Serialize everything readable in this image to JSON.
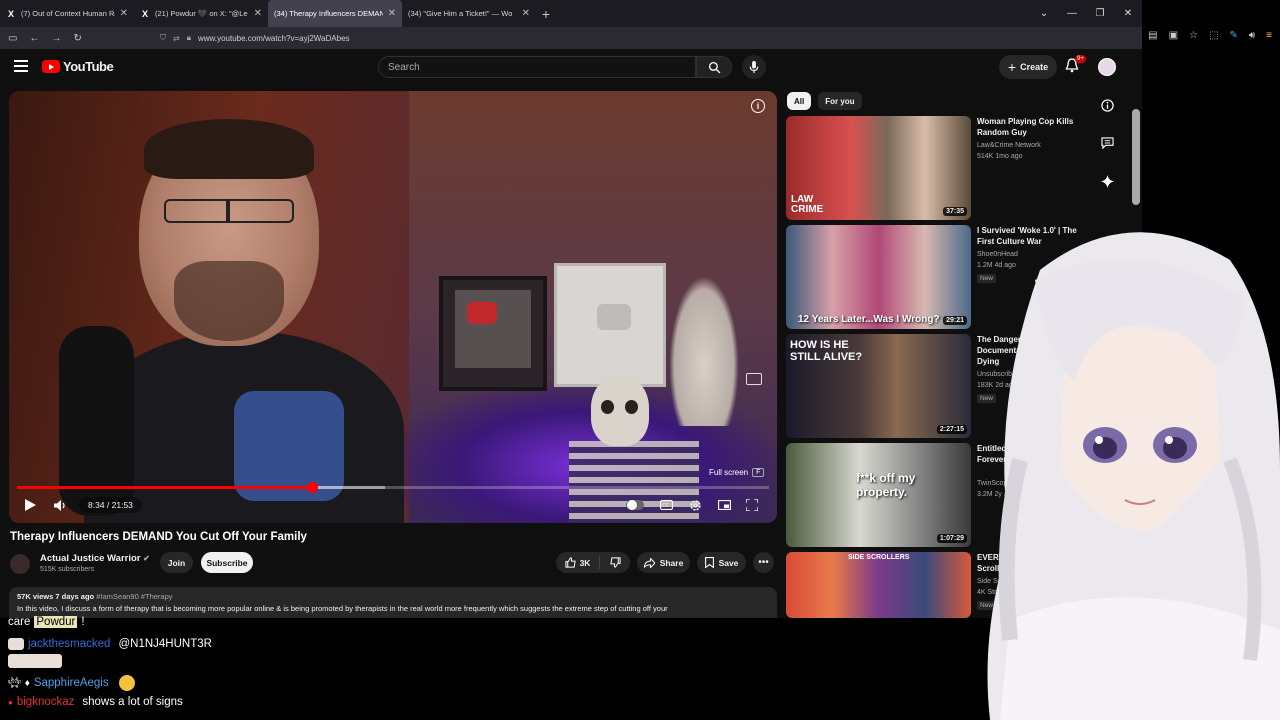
{
  "browser": {
    "tabs": [
      {
        "title": "(7) Out of Context Human Race",
        "icon": "x-icon",
        "active": false
      },
      {
        "title": "(21) Powdur 🖤 on X: \"@Le",
        "icon": "x-icon",
        "active": false
      },
      {
        "title": "(34) Therapy Influencers DEMAN",
        "icon": "youtube-icon",
        "active": true
      },
      {
        "title": "(34) \"Give Him a Ticket!\" — Wo",
        "icon": "youtube-icon",
        "active": false
      }
    ],
    "url": "www.youtube.com/watch?v=ayj2WaDAbes"
  },
  "youtube": {
    "logo_text": "YouTube",
    "search_placeholder": "Search",
    "create_label": "Create",
    "notification_count": "9+",
    "player": {
      "current_time": "8:34",
      "duration": "21:53",
      "time_display": "8:34 / 21:53",
      "progress_fraction": 0.392,
      "buffered_fraction": 0.49,
      "tooltip_label": "Full screen",
      "tooltip_key": "F"
    },
    "video": {
      "title": "Therapy Influencers DEMAND You Cut Off Your Family",
      "channel": "Actual Justice Warrior",
      "subscribers": "515K subscribers",
      "join_label": "Join",
      "subscribe_label": "Subscribe",
      "likes": "3K",
      "share_label": "Share",
      "save_label": "Save",
      "views_date": "57K views  7 days ago",
      "tags": "#IamSean90 #Therapy",
      "description": "In this video, I discuss a form of therapy that is becoming more popular online & is being promoted by therapists in the real world more frequently which suggests the extreme step of cutting off your"
    },
    "chips": [
      {
        "label": "All",
        "selected": true
      },
      {
        "label": "For you",
        "selected": false
      }
    ],
    "recommendations": [
      {
        "title": "Woman Playing Cop Kills Random Guy",
        "channel": "Law&Crime Network",
        "stats": "514K  1mo ago",
        "duration": "37:35",
        "badge": "",
        "thumb_text": "LAW CRIME"
      },
      {
        "title": "I Survived 'Woke 1.0' | The First Culture War",
        "channel": "Shoe0nHead",
        "stats": "1.2M  4d ago",
        "duration": "29:21",
        "badge": "New",
        "thumb_text": "12 Years Later...Was I Wrong?"
      },
      {
        "title": "The Dangers Of Y Documentaries Almost Dying",
        "channel": "Unsubscribe Po",
        "stats": "183K  2d ago",
        "duration": "2:27:15",
        "badge": "New",
        "thumb_text": "HOW IS HE STILL ALIVE?"
      },
      {
        "title": "Entitled Y They're Going Forever",
        "channel": "TwinScopeCops",
        "stats": "3.2M  2y ago",
        "duration": "1:07:29",
        "badge": "",
        "thumb_text": "f**k off my property."
      },
      {
        "title": "EVERYTHING IS FAK | Side Scrollers Live",
        "channel": "Side Scrollers",
        "stats": "4K  Streamed 46",
        "duration": "",
        "badge": "New",
        "thumb_text": "SIDE SCROLLERS"
      }
    ]
  },
  "chat": {
    "line1_pre": "care",
    "line1_highlight": "Powdur",
    "line1_post": "!",
    "line2_user": "jackthesmacked",
    "line2_text": "@N1NJ4HUNT3R",
    "line3_user": "SapphireAegis",
    "line4_user": "bigknockaz",
    "line4_text": "shows a lot of signs"
  },
  "colors": {
    "youtube_red": "#ff0000",
    "page_bg": "#0f0f0f",
    "chip_bg": "#272727"
  }
}
